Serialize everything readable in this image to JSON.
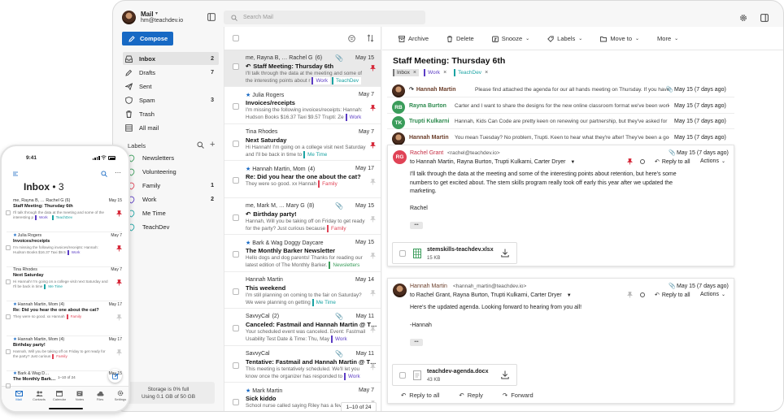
{
  "colors": {
    "accent": "#1769c4",
    "purple": "#5b3cc4",
    "green": "#3a9c5a",
    "teal": "#1aa3a3",
    "red": "#e04356",
    "orange": "#e0892a",
    "yellow": "#c9a800"
  },
  "account": {
    "app": "Mail",
    "email": "hm@teachdev.io"
  },
  "search": {
    "placeholder": "Search Mail"
  },
  "compose": "Compose",
  "folders": [
    {
      "label": "Inbox",
      "count": "2",
      "icon": "inbox-icon"
    },
    {
      "label": "Drafts",
      "count": "7",
      "icon": "drafts-icon"
    },
    {
      "label": "Sent",
      "count": "",
      "icon": "sent-icon"
    },
    {
      "label": "Spam",
      "count": "3",
      "icon": "spam-icon"
    },
    {
      "label": "Trash",
      "count": "",
      "icon": "trash-icon"
    },
    {
      "label": "All mail",
      "count": "",
      "icon": "all-mail-icon"
    }
  ],
  "labels_title": "Labels",
  "labels": [
    {
      "label": "Newsletters",
      "count": "",
      "color": "#3a9c5a"
    },
    {
      "label": "Volunteering",
      "count": "",
      "color": "#3a9c5a"
    },
    {
      "label": "Family",
      "count": "1",
      "color": "#e04356"
    },
    {
      "label": "Work",
      "count": "2",
      "color": "#5b3cc4"
    },
    {
      "label": "Me Time",
      "count": "",
      "color": "#1aa3a3"
    },
    {
      "label": "TeachDev",
      "count": "",
      "color": "#1aa3a3"
    }
  ],
  "storage": {
    "line1": "Storage is 0% full",
    "line2": "Using 0.1 GB of 50 GB"
  },
  "messages": [
    {
      "from": "me, Rayna B, … Rachel G",
      "cnt": "(6)",
      "date": "May 15",
      "subject": "Staff Meeting: Thursday 6th",
      "preview": "I'll talk through the data at the meeting and some of the interesting points about r",
      "labels": [
        {
          "t": "Work",
          "c": "#5b3cc4"
        },
        {
          "t": "TeachDev",
          "c": "#1aa3a3"
        }
      ],
      "selected": true,
      "attach": true,
      "reply": true,
      "pinned": true
    },
    {
      "from": "Julia Rogers",
      "cnt": "",
      "date": "May 7",
      "subject": "Invoices/receipts",
      "preview": "I'm missing the following invoices/receipts: Hannah: Hudson Books $16.37 Taxi $9.57 Trupti: Ze",
      "labels": [
        {
          "t": "Work",
          "c": "#5b3cc4"
        }
      ],
      "star": true,
      "pinned": true
    },
    {
      "from": "Tina Rhodes",
      "cnt": "",
      "date": "May 7",
      "subject": "Next Saturday",
      "preview": "Hi Hannah! I'm going on a college visit next Saturday and I'll be back in time to",
      "labels": [
        {
          "t": "Me Time",
          "c": "#1aa3a3"
        }
      ],
      "pinned": true
    },
    {
      "from": "Hannah Martin, Mom",
      "cnt": "(4)",
      "date": "May 17",
      "subject": "Re: Did you hear the one about the cat?",
      "preview": "They were so good. xx Hannah",
      "labels": [
        {
          "t": "Family",
          "c": "#e04356"
        }
      ],
      "star": true
    },
    {
      "from": "me, Mark M, … Mary G",
      "cnt": "(8)",
      "date": "May 15",
      "subject": "Birthday party!",
      "preview": "Hannah, Will you be taking off on Friday to get ready for the party? Just curious because",
      "labels": [
        {
          "t": "Family",
          "c": "#e04356"
        }
      ],
      "attach": true,
      "reply": true
    },
    {
      "from": "Bark & Wag Doggy Daycare",
      "cnt": "",
      "date": "May 15",
      "subject": "The Monthly Barker Newsletter",
      "preview": "Hello dogs and dog parents! Thanks for reading our latest edition of The Monthly Barker.",
      "labels": [
        {
          "t": "Newsletters",
          "c": "#3a9c5a"
        }
      ],
      "star": true
    },
    {
      "from": "Hannah Martin",
      "cnt": "",
      "date": "May 14",
      "subject": "This weekend",
      "preview": "I'm still planning on coming to the fair on Saturday? We were planning on getting",
      "labels": [
        {
          "t": "Me Time",
          "c": "#1aa3a3"
        }
      ]
    },
    {
      "from": "SavvyCal",
      "cnt": "(2)",
      "date": "May 11",
      "subject": "Canceled: Fastmail and Hannah Martin @ T…",
      "preview": "Your scheduled event was canceled. Event: Fastmail Usability Test Date & Time: Thu, May",
      "labels": [
        {
          "t": "Work",
          "c": "#5b3cc4"
        }
      ],
      "attach": true
    },
    {
      "from": "SavvyCal",
      "cnt": "",
      "date": "May 11",
      "subject": "Tentative: Fastmail and Hannah Martin @ T…",
      "preview": "This meeting is tentatively scheduled. We'll let you know once the organizer has responded to",
      "labels": [
        {
          "t": "Work",
          "c": "#5b3cc4"
        }
      ],
      "attach": true
    },
    {
      "from": "Mark Martin",
      "cnt": "",
      "date": "May 7",
      "subject": "Sick kiddo",
      "preview": "School nurse called saying Riley has a fever",
      "labels": [],
      "star": true
    }
  ],
  "pager": "1–10 of 24",
  "toolbar": {
    "archive": "Archive",
    "delete": "Delete",
    "snooze": "Snooze",
    "labels": "Labels",
    "move": "Move to",
    "more": "More"
  },
  "thread": {
    "title": "Staff Meeting: Thursday 6th",
    "tags": [
      {
        "t": "Inbox",
        "c": "#777"
      },
      {
        "t": "Work",
        "c": "#5b3cc4"
      },
      {
        "t": "TeachDev",
        "c": "#1aa3a3"
      }
    ],
    "collapsed": [
      {
        "name": "Hannah Martin",
        "snippet": "Please find attached the agenda for our all hands meeting on Thursday. If you have",
        "date": "May 15 (7 days ago)",
        "initials": "",
        "color": "#6b3e2a",
        "reply": true,
        "attach": true
      },
      {
        "name": "Rayna Burton",
        "snippet": "Carter and I want to share the designs for the new online classroom format we've been workin",
        "date": "May 15 (7 days ago)",
        "initials": "RB",
        "color": "#3a9c5a"
      },
      {
        "name": "Trupti Kulkarni",
        "snippet": "Hannah, Kids Can Code are pretty keen on renewing our partnership, but they've asked for",
        "date": "May 15 (7 days ago)",
        "initials": "TK",
        "color": "#3a9c5a"
      },
      {
        "name": "Hannah Martin",
        "snippet": "You mean Tuesday? No problem, Trupti. Keen to hear what they're after! They've been a goo",
        "date": "May 15 (7 days ago)",
        "initials": "",
        "color": "#6b3e2a"
      }
    ],
    "expanded": [
      {
        "name": "Rachel Grant",
        "addr": "<rachel@teachdev.io>",
        "initials": "RG",
        "color": "#e04356",
        "date": "May 15 (7 days ago)",
        "to": "to Hannah Martin, Rayna Burton, Trupti Kulkarni, Carter Dryer",
        "body": "I'll talk through the data at the meeting and some of the interesting points about retention, but here's some numbers to get excited about. The stem skills program really took off early this year after we updated the marketing.",
        "sign": "Rachel",
        "file": "stemskills-teachdev.xlsx",
        "size": "15 KB"
      },
      {
        "name": "Hannah Martin",
        "addr": "<hannah_martin@teachdev.io>",
        "initials": "",
        "color": "#6b3e2a",
        "date": "May 15 (7 days ago)",
        "to": "to Rachel Grant, Rayna Burton, Trupti Kulkarni, Carter Dryer",
        "body": "Here's the updated agenda. Looking forward to hearing from you all!",
        "sign": "-Hannah",
        "file": "teachdev-agenda.docx",
        "size": "43 KB"
      }
    ],
    "reply_all": "Reply to all",
    "actions": "Actions",
    "more_dots": "•••",
    "reply": "Reply",
    "forward": "Forward"
  },
  "phone": {
    "time": "9:41",
    "title": "Inbox",
    "count": "• 3",
    "rows": [
      {
        "from": "me, Rayna B, … Rachel G (6)",
        "date": "May 15",
        "subject": "Staff Meeting: Thursday 6th",
        "preview": "I'll talk through the data at the meeting and some of the interesting p",
        "labels": [
          {
            "t": "Work",
            "c": "#5b3cc4"
          },
          {
            "t": "TeachDev",
            "c": "#1aa3a3"
          }
        ]
      },
      {
        "from": "Julia Rogers",
        "date": "May 7",
        "subject": "Invoices/receipts",
        "preview": "I'm missing the following invoices/receipts: Hannah: Hudson Books $16.37 Taxi $9.5",
        "labels": [
          {
            "t": "Work",
            "c": "#5b3cc4"
          }
        ]
      },
      {
        "from": "Tina Rhodes",
        "date": "May 7",
        "subject": "Next Saturday",
        "preview": "Hi Hannah! I'm going on a college visit next Saturday and I'll be back in time",
        "labels": [
          {
            "t": "Me Time",
            "c": "#1aa3a3"
          }
        ]
      },
      {
        "from": "Hannah Martin, Mom (4)",
        "date": "May 17",
        "subject": "Re: Did you hear the one about the cat?",
        "preview": "They were so good. xx Hannah",
        "labels": [
          {
            "t": "Family",
            "c": "#e04356"
          }
        ]
      },
      {
        "from": "Hannah Martin, Mom (4)",
        "date": "May 17",
        "subject": "Birthday party!",
        "preview": "Hannah, Will you be taking off on Friday to get ready for the party? Just curious",
        "labels": [
          {
            "t": "Family",
            "c": "#e04356"
          }
        ]
      },
      {
        "from": "Bark & Wag D…",
        "date": "May 15",
        "subject": "The Monthly Bark…",
        "preview": "",
        "labels": []
      }
    ],
    "pager": "1–10 of 24",
    "tabs": [
      "Mail",
      "Contacts",
      "Calendar",
      "Notes",
      "Files",
      "Settings"
    ]
  }
}
